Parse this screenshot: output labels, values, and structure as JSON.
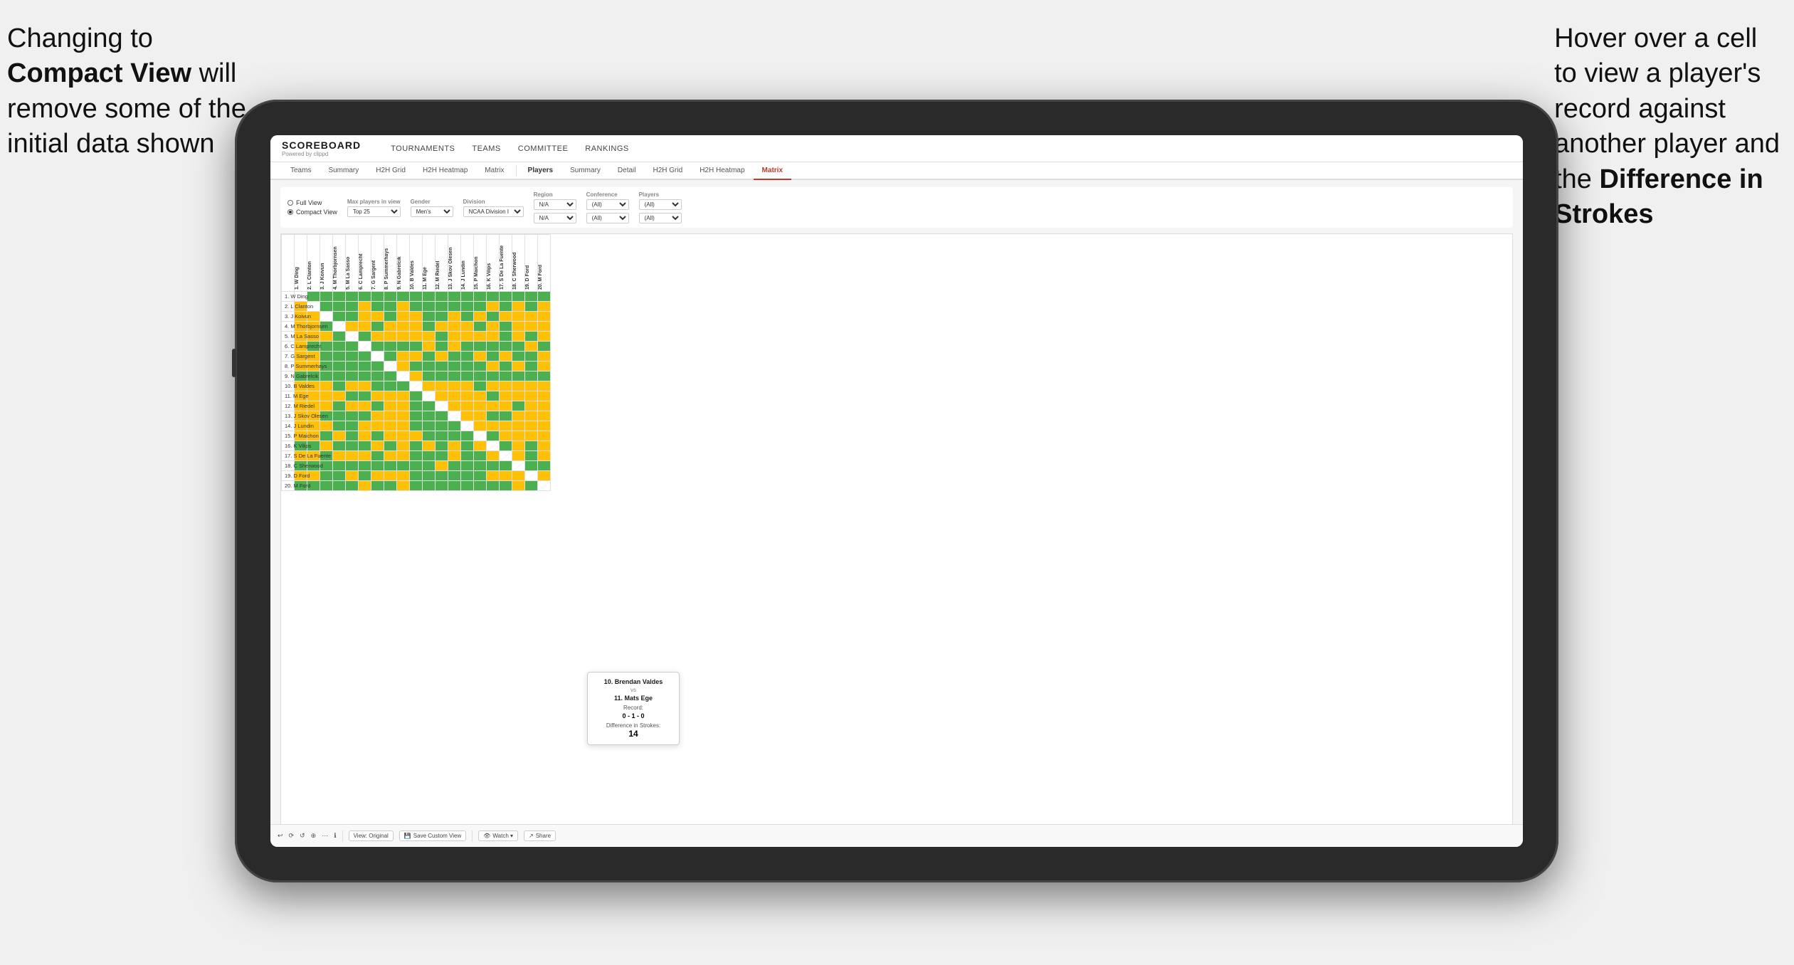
{
  "annotations": {
    "left": {
      "line1": "Changing to",
      "line2bold": "Compact View",
      "line2rest": " will",
      "line3": "remove some of the",
      "line4": "initial data shown"
    },
    "right": {
      "line1": "Hover over a cell",
      "line2": "to view a player's",
      "line3": "record against",
      "line4": "another player and",
      "line5start": "the ",
      "line5bold": "Difference in",
      "line6bold": "Strokes"
    }
  },
  "header": {
    "logo_title": "SCOREBOARD",
    "logo_sub": "Powered by clippd",
    "nav": [
      "TOURNAMENTS",
      "TEAMS",
      "COMMITTEE",
      "RANKINGS"
    ]
  },
  "tabs": {
    "left_group": [
      "Teams",
      "Summary",
      "H2H Grid",
      "H2H Heatmap",
      "Matrix"
    ],
    "right_group_label": "Players",
    "right_group": [
      "Summary",
      "Detail",
      "H2H Grid",
      "H2H Heatmap",
      "Matrix"
    ],
    "active": "Matrix"
  },
  "filters": {
    "view_options": [
      "Full View",
      "Compact View"
    ],
    "selected_view": "Compact View",
    "max_players_label": "Max players in view",
    "max_players_value": "Top 25",
    "gender_label": "Gender",
    "gender_value": "Men's",
    "division_label": "Division",
    "division_value": "NCAA Division I",
    "region_label": "Region",
    "region_values": [
      "N/A",
      "N/A"
    ],
    "conference_label": "Conference",
    "conference_values": [
      "(All)",
      "(All)"
    ],
    "players_label": "Players",
    "players_values": [
      "(All)",
      "(All)"
    ]
  },
  "matrix": {
    "col_headers": [
      "1. W Ding",
      "2. L Clanton",
      "3. J Koivun",
      "4. M Thorbjornsen",
      "5. M La Sasso",
      "6. C Lamprecht",
      "7. G Sargent",
      "8. P Summerhays",
      "9. N Gabrelcik",
      "10. B Valdes",
      "11. M Ege",
      "12. M Riedel",
      "13. J Skov Olesen",
      "14. J Lundin",
      "15. P Maichon",
      "16. K Vilips",
      "17. S De La Fuente",
      "18. C Sherwood",
      "19. D Ford",
      "20. M Ford"
    ],
    "row_players": [
      "1. W Ding",
      "2. L Clanton",
      "3. J Koivun",
      "4. M Thorbjornsen",
      "5. M La Sasso",
      "6. C Lamprecht",
      "7. G Sargent",
      "8. P Summerhays",
      "9. N Gabrelcik",
      "10. B Valdes",
      "11. M Ege",
      "12. M Riedel",
      "13. J Skov Olesen",
      "14. J Lundin",
      "15. P Maichon",
      "16. K Vilips",
      "17. S De La Fuente",
      "18. C Sherwood",
      "19. D Ford",
      "20. M Ford"
    ],
    "cell_colors": [
      [
        "d",
        "g",
        "g",
        "g",
        "g",
        "g",
        "g",
        "g",
        "g",
        "g",
        "g",
        "g",
        "g",
        "g",
        "g",
        "g",
        "g",
        "g",
        "g",
        "g"
      ],
      [
        "y",
        "d",
        "g",
        "g",
        "g",
        "y",
        "g",
        "g",
        "y",
        "g",
        "g",
        "g",
        "g",
        "g",
        "g",
        "y",
        "g",
        "y",
        "g",
        "y"
      ],
      [
        "y",
        "y",
        "d",
        "g",
        "g",
        "y",
        "y",
        "g",
        "y",
        "y",
        "g",
        "g",
        "y",
        "g",
        "y",
        "g",
        "y",
        "y",
        "y",
        "y"
      ],
      [
        "y",
        "y",
        "g",
        "d",
        "y",
        "y",
        "g",
        "y",
        "y",
        "y",
        "g",
        "y",
        "y",
        "y",
        "g",
        "y",
        "g",
        "y",
        "y",
        "y"
      ],
      [
        "y",
        "y",
        "y",
        "g",
        "d",
        "g",
        "y",
        "y",
        "y",
        "y",
        "y",
        "g",
        "y",
        "y",
        "y",
        "y",
        "g",
        "y",
        "g",
        "y"
      ],
      [
        "y",
        "g",
        "g",
        "g",
        "g",
        "d",
        "g",
        "g",
        "g",
        "g",
        "y",
        "g",
        "y",
        "g",
        "g",
        "g",
        "g",
        "g",
        "y",
        "g"
      ],
      [
        "y",
        "y",
        "g",
        "g",
        "g",
        "g",
        "d",
        "g",
        "y",
        "y",
        "g",
        "y",
        "g",
        "g",
        "y",
        "g",
        "y",
        "g",
        "g",
        "y"
      ],
      [
        "y",
        "y",
        "g",
        "g",
        "g",
        "g",
        "g",
        "d",
        "y",
        "g",
        "g",
        "g",
        "g",
        "g",
        "g",
        "y",
        "g",
        "y",
        "g",
        "y"
      ],
      [
        "g",
        "g",
        "g",
        "g",
        "g",
        "g",
        "g",
        "g",
        "d",
        "y",
        "g",
        "g",
        "g",
        "g",
        "g",
        "g",
        "g",
        "g",
        "g",
        "g"
      ],
      [
        "y",
        "y",
        "y",
        "g",
        "y",
        "y",
        "g",
        "g",
        "g",
        "d",
        "y",
        "y",
        "y",
        "y",
        "g",
        "y",
        "y",
        "y",
        "y",
        "y"
      ],
      [
        "y",
        "y",
        "y",
        "y",
        "g",
        "g",
        "y",
        "y",
        "y",
        "g",
        "d",
        "y",
        "y",
        "y",
        "y",
        "g",
        "y",
        "y",
        "y",
        "y"
      ],
      [
        "y",
        "y",
        "y",
        "g",
        "y",
        "y",
        "g",
        "y",
        "y",
        "g",
        "g",
        "d",
        "y",
        "y",
        "y",
        "y",
        "y",
        "g",
        "y",
        "y"
      ],
      [
        "y",
        "y",
        "g",
        "g",
        "g",
        "g",
        "y",
        "y",
        "y",
        "g",
        "g",
        "g",
        "d",
        "y",
        "y",
        "g",
        "g",
        "y",
        "y",
        "y"
      ],
      [
        "y",
        "y",
        "y",
        "g",
        "g",
        "y",
        "y",
        "y",
        "y",
        "g",
        "g",
        "g",
        "g",
        "d",
        "y",
        "y",
        "y",
        "y",
        "y",
        "y"
      ],
      [
        "y",
        "y",
        "g",
        "y",
        "g",
        "y",
        "g",
        "y",
        "y",
        "y",
        "g",
        "g",
        "g",
        "g",
        "d",
        "g",
        "y",
        "y",
        "y",
        "y"
      ],
      [
        "g",
        "g",
        "y",
        "g",
        "g",
        "g",
        "y",
        "g",
        "y",
        "g",
        "y",
        "g",
        "y",
        "g",
        "y",
        "d",
        "g",
        "y",
        "g",
        "y"
      ],
      [
        "y",
        "y",
        "g",
        "y",
        "y",
        "y",
        "g",
        "y",
        "y",
        "g",
        "g",
        "g",
        "y",
        "g",
        "g",
        "y",
        "d",
        "y",
        "g",
        "y"
      ],
      [
        "g",
        "g",
        "g",
        "g",
        "g",
        "g",
        "g",
        "g",
        "g",
        "g",
        "g",
        "y",
        "g",
        "g",
        "g",
        "g",
        "g",
        "d",
        "g",
        "g"
      ],
      [
        "y",
        "y",
        "g",
        "g",
        "y",
        "g",
        "y",
        "y",
        "y",
        "g",
        "g",
        "g",
        "g",
        "g",
        "g",
        "y",
        "y",
        "y",
        "d",
        "y"
      ],
      [
        "g",
        "g",
        "g",
        "g",
        "g",
        "y",
        "g",
        "g",
        "y",
        "g",
        "g",
        "g",
        "g",
        "g",
        "g",
        "g",
        "g",
        "y",
        "g",
        "d"
      ]
    ]
  },
  "tooltip": {
    "player1": "10. Brendan Valdes",
    "vs": "vs",
    "player2": "11. Mats Ege",
    "record_label": "Record:",
    "record": "0 - 1 - 0",
    "diff_label": "Difference in Strokes:",
    "diff": "14"
  },
  "toolbar": {
    "undo": "↩",
    "redo": "↪",
    "view_original": "View: Original",
    "save_custom": "Save Custom View",
    "watch": "Watch ▾",
    "share": "Share"
  }
}
